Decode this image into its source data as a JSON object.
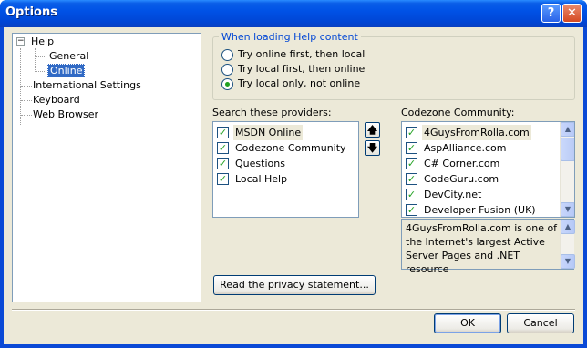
{
  "window": {
    "title": "Options"
  },
  "titlebar": {
    "help_glyph": "?",
    "close_glyph": "✕"
  },
  "tree": {
    "root": "Help",
    "children": [
      "General",
      "Online"
    ],
    "selected": "Online",
    "others": [
      "International Settings",
      "Keyboard",
      "Web Browser"
    ]
  },
  "loading": {
    "title": "When loading Help content",
    "options": [
      "Try online first, then local",
      "Try local first, then online",
      "Try local only, not online"
    ],
    "selected_index": 2
  },
  "providers": {
    "label": "Search these providers:",
    "items": [
      "MSDN Online",
      "Codezone Community",
      "Questions",
      "Local Help"
    ],
    "checked": [
      true,
      true,
      true,
      true
    ]
  },
  "codezone": {
    "label": "Codezone Community:",
    "items": [
      "4GuysFromRolla.com",
      "AspAlliance.com",
      "C# Corner.com",
      "CodeGuru.com",
      "DevCity.net",
      "Developer Fusion (UK)"
    ],
    "checked": [
      true,
      true,
      true,
      true,
      true,
      true
    ],
    "description": "4GuysFromRolla.com is one of the Internet's largest Active Server Pages and .NET resource"
  },
  "privacy_button": "Read the privacy statement...",
  "footer": {
    "ok": "OK",
    "cancel": "Cancel"
  },
  "colors": {
    "title_blue": "#0052e6",
    "client": "#ece9d8",
    "selection": "#316ac5",
    "check_green": "#21a121"
  }
}
